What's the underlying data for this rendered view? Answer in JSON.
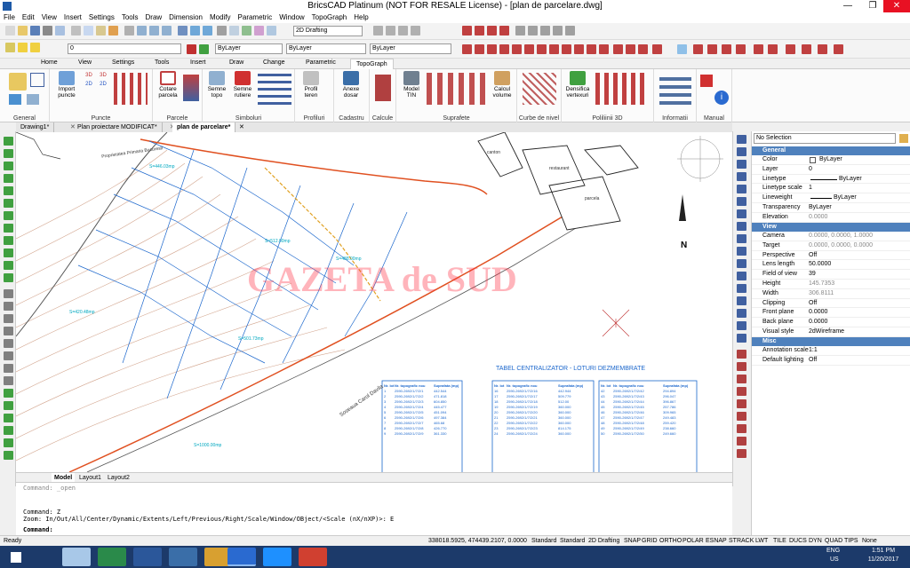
{
  "window": {
    "title": "BricsCAD Platinum (NOT FOR RESALE License) - [plan de parcelare.dwg]",
    "minimize": "—",
    "maximize": "❐",
    "close": "✕"
  },
  "menu": [
    "File",
    "Edit",
    "View",
    "Insert",
    "Settings",
    "Tools",
    "Draw",
    "Dimension",
    "Modify",
    "Parametric",
    "Window",
    "TopoGraph",
    "Help"
  ],
  "toolbar": {
    "workspace": "2D Drafting",
    "layer": "0",
    "color": "ByLayer",
    "linetype": "ByLayer",
    "lineweight": "ByLayer"
  },
  "ribbon_tabs": [
    "Home",
    "View",
    "Settings",
    "Tools",
    "Insert",
    "Draw",
    "Change",
    "Parametric",
    "TopoGraph"
  ],
  "ribbon_active_tab": "TopoGraph",
  "ribbon_panels": [
    {
      "title": "General",
      "buttons": []
    },
    {
      "title": "Puncte",
      "buttons": [
        "Import puncte",
        "3D",
        "2D",
        "3D",
        "2D"
      ]
    },
    {
      "title": "Parcele",
      "buttons": [
        "Cotare parcela"
      ]
    },
    {
      "title": "Simboluri",
      "buttons": [
        "Semne topo",
        "Semne rutiere"
      ]
    },
    {
      "title": "Profiluri",
      "buttons": [
        "Profil teren"
      ]
    },
    {
      "title": "Cadastru",
      "buttons": [
        "Anexe dosar"
      ]
    },
    {
      "title": "Calcule",
      "buttons": []
    },
    {
      "title": "Suprafete",
      "buttons": [
        "Model TIN",
        "Calcul volume"
      ]
    },
    {
      "title": "Curbe de nivel",
      "buttons": []
    },
    {
      "title": "Poliliinii 3D",
      "buttons": [
        "Densifica vertexuri"
      ]
    },
    {
      "title": "Informatii",
      "buttons": []
    },
    {
      "title": "Manual",
      "buttons": []
    }
  ],
  "doc_tabs": [
    "Drawing1*",
    "Plan proiectare MODIFICAT*",
    "plan de parcelare*"
  ],
  "doc_tab_close": "✕",
  "layout_tabs": [
    "Model",
    "Layout1",
    "Layout2"
  ],
  "drawing": {
    "table_title": "TABEL CENTRALIZATOR - LOTURI DEZMEMBRATE",
    "watermark": "GAZETA de SUD",
    "north": "N",
    "labels": [
      "Proprietatea Primaria Bucuresti",
      "canton",
      "restaurant",
      "parcela",
      "Soseaua Carol Davila",
      "S=446.03mp",
      "S=512.00mp",
      "S=1000.00mp",
      "S=420.48mp",
      "S=488.00mp",
      "S=501.73mp"
    ],
    "table_headers": [
      "Nr. lot",
      "Nr. topografic nou",
      "Suprafata (mp)"
    ],
    "table1_rows": [
      [
        "1",
        "2590-2692/1/7/2/1",
        "442.544"
      ],
      [
        "2",
        "2590-2692/1/7/2/2",
        "471.818"
      ],
      [
        "3",
        "2590-2692/1/7/2/3",
        "604.850"
      ],
      [
        "4",
        "2590-2692/1/7/2/4",
        "445.477"
      ],
      [
        "5",
        "2590-2692/1/7/2/5",
        "451.094"
      ],
      [
        "6",
        "2590-2692/1/7/2/6",
        "497.384"
      ],
      [
        "7",
        "2590-2692/1/7/2/7",
        "465.68"
      ],
      [
        "8",
        "2590-2692/1/7/2/8",
        "426.770"
      ],
      [
        "9",
        "2590-2692/1/7/2/9",
        "361.330"
      ]
    ],
    "table2_rows": [
      [
        "16",
        "2590-2692/1/7/2/16",
        "442.944"
      ],
      [
        "17",
        "2590-2692/1/7/2/17",
        "509.779"
      ],
      [
        "18",
        "2590-2692/1/7/2/18",
        "512.00"
      ],
      [
        "19",
        "2590-2692/1/7/2/19",
        "360.000"
      ],
      [
        "20",
        "2590-2692/1/7/2/20",
        "360.000"
      ],
      [
        "21",
        "2590-2692/1/7/2/21",
        "360.000"
      ],
      [
        "22",
        "2590-2692/1/7/2/22",
        "360.000"
      ],
      [
        "23",
        "2590-2692/1/7/2/23",
        "814.175"
      ],
      [
        "24",
        "2590-2692/1/7/2/24",
        "360.000"
      ]
    ],
    "table3_rows": [
      [
        "42",
        "2590-2692/1/7/2/42",
        "294.894"
      ],
      [
        "43",
        "2590-2692/1/7/2/43",
        "296.047"
      ],
      [
        "44",
        "2590-2692/1/7/2/44",
        "396.867"
      ],
      [
        "45",
        "2590-2692/1/7/2/45",
        "257.786"
      ],
      [
        "46",
        "2590-2692/1/7/2/46",
        "309.965"
      ],
      [
        "47",
        "2590-2692/1/7/2/47",
        "249.483"
      ],
      [
        "48",
        "2590-2692/1/7/2/48",
        "259.420"
      ],
      [
        "49",
        "2590-2692/1/7/2/49",
        "238.660"
      ],
      [
        "50",
        "2590-2692/1/7/2/50",
        "249.660"
      ]
    ]
  },
  "command": {
    "line1": "Command: _open",
    "line2": "Command: Z",
    "line3": "Zoom:  In/Out/All/Center/Dynamic/Extents/Left/Previous/Right/Scale/Window/OBject/<Scale (nX/nXP)>: E",
    "prompt": "Command:"
  },
  "properties": {
    "selection": "No Selection",
    "sections": [
      {
        "name": "General",
        "rows": [
          [
            "Color",
            "ByLayer"
          ],
          [
            "Layer",
            "0"
          ],
          [
            "Linetype",
            "ByLayer"
          ],
          [
            "Linetype scale",
            "1"
          ],
          [
            "Lineweight",
            "ByLayer"
          ],
          [
            "Transparency",
            "ByLayer"
          ],
          [
            "Elevation",
            "0.0000"
          ]
        ]
      },
      {
        "name": "View",
        "rows": [
          [
            "Camera",
            "0.0000, 0.0000, 1.0000"
          ],
          [
            "Target",
            "0.0000, 0.0000, 0.0000"
          ],
          [
            "Perspective",
            "Off"
          ],
          [
            "Lens length",
            "50.0000"
          ],
          [
            "Field of view",
            "39"
          ],
          [
            "Height",
            "145.7353"
          ],
          [
            "Width",
            "306.8111"
          ],
          [
            "Clipping",
            "Off"
          ],
          [
            "Front plane",
            "0.0000"
          ],
          [
            "Back plane",
            "0.0000"
          ],
          [
            "Visual style",
            "2dWireframe"
          ]
        ]
      },
      {
        "name": "Misc",
        "rows": [
          [
            "Annotation scale",
            "1:1"
          ],
          [
            "Default lighting",
            "Off"
          ]
        ]
      }
    ]
  },
  "status": {
    "ready": "Ready",
    "coords": "338018.5925, 474439.2107, 0.0000",
    "items": [
      "Standard",
      "Standard",
      "2D Drafting",
      "SNAP",
      "GRID",
      "ORTHO",
      "POLAR",
      "ESNAP",
      "STRACK",
      "LWT",
      "TILE",
      "DUCS",
      "DYN",
      "QUAD",
      "TIPS",
      "None"
    ]
  },
  "taskbar": {
    "lang": "ENG",
    "region": "US",
    "time": "1:51 PM",
    "date": "11/20/2017"
  },
  "colors": {
    "accent": "#4f81bd",
    "taskbar": "#1c3a6a",
    "road": "#e05020",
    "parcel": "#1a66cc",
    "cyan": "#00bcd4"
  }
}
